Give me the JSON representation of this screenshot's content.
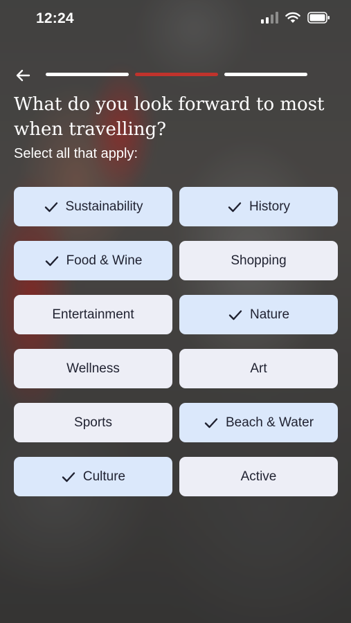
{
  "status_bar": {
    "time": "12:24"
  },
  "progress": {
    "steps": 3,
    "current_step": 2
  },
  "colors": {
    "accent": "#c0332c",
    "option_bg": "#edeef6",
    "option_selected_bg": "#dbe8fb",
    "text_dark": "#1f2130"
  },
  "question": {
    "title": "What do you look forward to most when travelling?",
    "subtitle": "Select all that apply:"
  },
  "options": [
    {
      "label": "Sustainability",
      "selected": true
    },
    {
      "label": "History",
      "selected": true
    },
    {
      "label": "Food & Wine",
      "selected": true
    },
    {
      "label": "Shopping",
      "selected": false
    },
    {
      "label": "Entertainment",
      "selected": false
    },
    {
      "label": "Nature",
      "selected": true
    },
    {
      "label": "Wellness",
      "selected": false
    },
    {
      "label": "Art",
      "selected": false
    },
    {
      "label": "Sports",
      "selected": false
    },
    {
      "label": "Beach & Water",
      "selected": true
    },
    {
      "label": "Culture",
      "selected": true
    },
    {
      "label": "Active",
      "selected": false
    }
  ],
  "icons": {
    "back": "arrow-left-icon",
    "check": "checkmark-icon",
    "signal": "cellular-signal-icon",
    "wifi": "wifi-icon",
    "battery": "battery-icon"
  }
}
